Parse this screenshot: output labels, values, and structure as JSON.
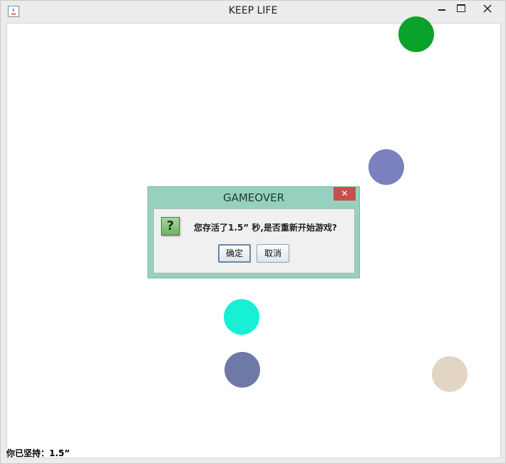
{
  "window": {
    "title": "KEEP LIFE",
    "minimize_glyph": "▁",
    "maximize_glyph": "☐",
    "close_glyph": "✕"
  },
  "game": {
    "balls": [
      {
        "name": "green-ball",
        "color": "#0aa22a"
      },
      {
        "name": "periwinkle-ball",
        "color": "#7b80bf"
      },
      {
        "name": "cyan-ball",
        "color": "#17f0d4"
      },
      {
        "name": "slate-ball",
        "color": "#6f79a8"
      },
      {
        "name": "beige-ball",
        "color": "#e2d5c4"
      }
    ]
  },
  "status": {
    "text": "你已坚持：1.5”"
  },
  "dialog": {
    "title": "GAMEOVER",
    "close_glyph": "✕",
    "icon_glyph": "?",
    "message": "您存活了1.5” 秒,是否重新开始游戏?",
    "ok_label": "确定",
    "cancel_label": "取消"
  }
}
